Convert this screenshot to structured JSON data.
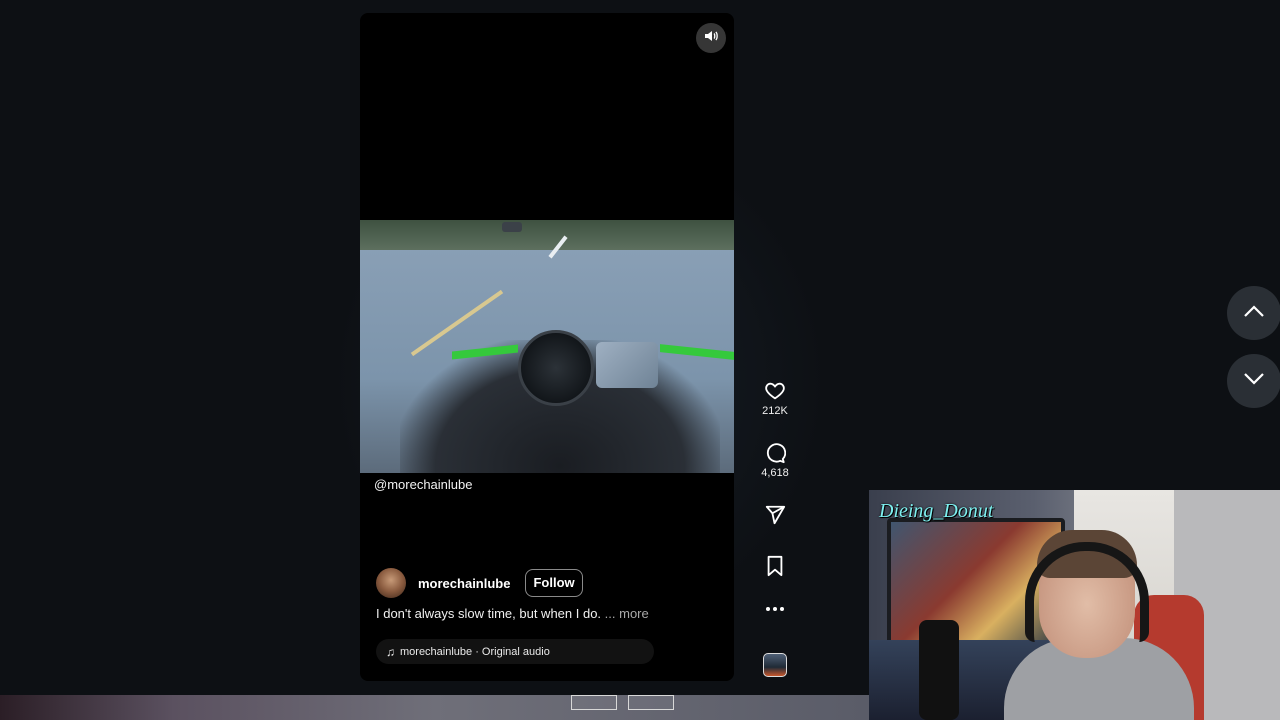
{
  "reel": {
    "video_handle": "@morechainlube",
    "author": "morechainlube",
    "follow_label": "Follow",
    "caption": "I don't always slow time, but when I do.",
    "caption_more": "... more",
    "audio_label": "morechainlube · Original audio"
  },
  "actions": {
    "likes": "212K",
    "comments": "4,618"
  },
  "webcam": {
    "streamer_name": "Dieing_Donut"
  },
  "icons": [
    "volume-icon",
    "heart-icon",
    "comment-icon",
    "share-icon",
    "bookmark-icon",
    "more-icon",
    "music-note-icon",
    "chevron-up-icon",
    "chevron-down-icon"
  ],
  "colors": {
    "background": "#0d1014",
    "follow_border": "#8a8a8a",
    "webcam_name": "#7ef0f0"
  }
}
